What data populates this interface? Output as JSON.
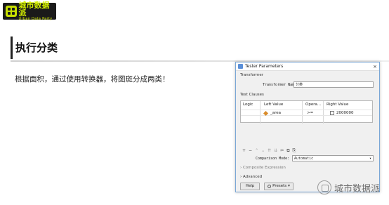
{
  "logo": {
    "cn": "城市数据派",
    "en": "Urban Data Party"
  },
  "slide": {
    "title": "执行分类",
    "body": "根据面积，通过使用转换器，将图斑分成两类！"
  },
  "dialog": {
    "title": "Tester Parameters",
    "close": "×",
    "transformer_section": "Transformer",
    "name_label": "Transformer Name:",
    "name_value": "分类",
    "clauses_section": "Test Clauses",
    "columns": [
      "Logic",
      "Left Value",
      "Opera...",
      "Right Value"
    ],
    "row": {
      "left": "_area",
      "op": ">=",
      "right": "2000000"
    },
    "toolbar": [
      "+",
      "−",
      "⌃",
      "⌄",
      "⇈",
      "⇊",
      "✂",
      "⧉",
      "⎘"
    ],
    "mode_label": "Comparison Mode:",
    "mode_value": "Automatic",
    "composite": "Composite Expression",
    "advanced": "Advanced",
    "help": "Help",
    "presets": "Presets"
  },
  "watermark": "城市数据派"
}
